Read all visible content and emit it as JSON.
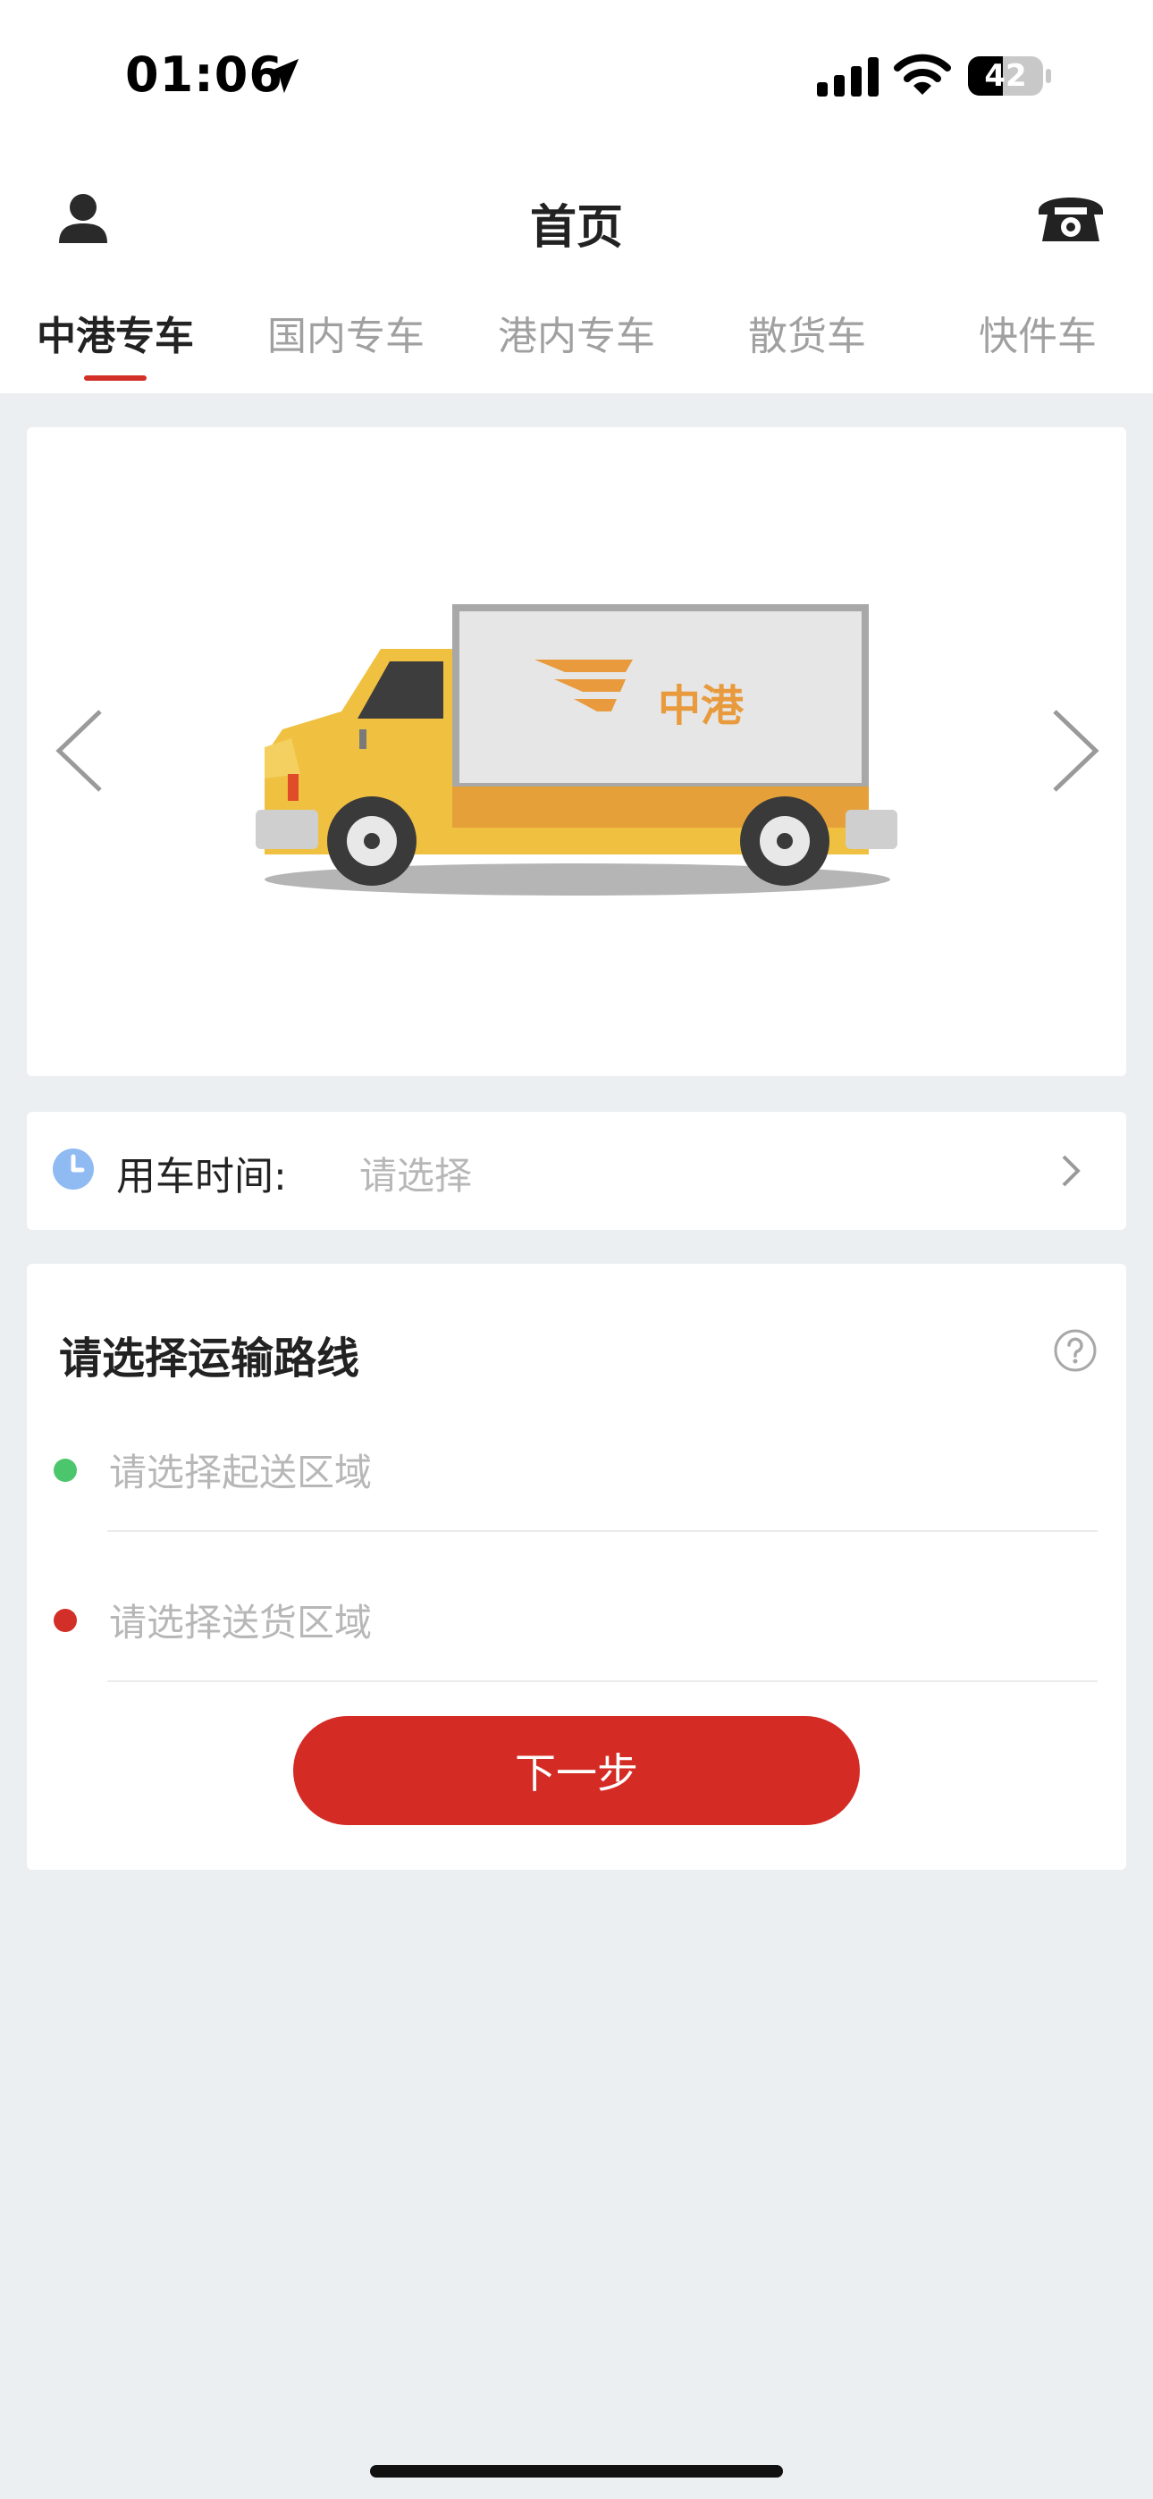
{
  "status_bar": {
    "time": "01:06",
    "battery": "42"
  },
  "header": {
    "title": "首页"
  },
  "tabs": [
    {
      "label": "中港专车",
      "active": true
    },
    {
      "label": "国内专车",
      "active": false
    },
    {
      "label": "港内专车",
      "active": false
    },
    {
      "label": "散货车",
      "active": false
    },
    {
      "label": "快件车",
      "active": false
    }
  ],
  "banner": {
    "truck_brand": "中港"
  },
  "time_row": {
    "label": "用车时间:",
    "value": "请选择"
  },
  "route": {
    "title": "请选择运输路线",
    "start_placeholder": "请选择起送区域",
    "end_placeholder": "请选择送货区域",
    "next_label": "下一步"
  },
  "colors": {
    "accent": "#d52b25",
    "start_dot": "#4cc66c",
    "end_dot": "#d12f27",
    "truck_yellow": "#f0c040",
    "brand_orange": "#e89a3c"
  }
}
